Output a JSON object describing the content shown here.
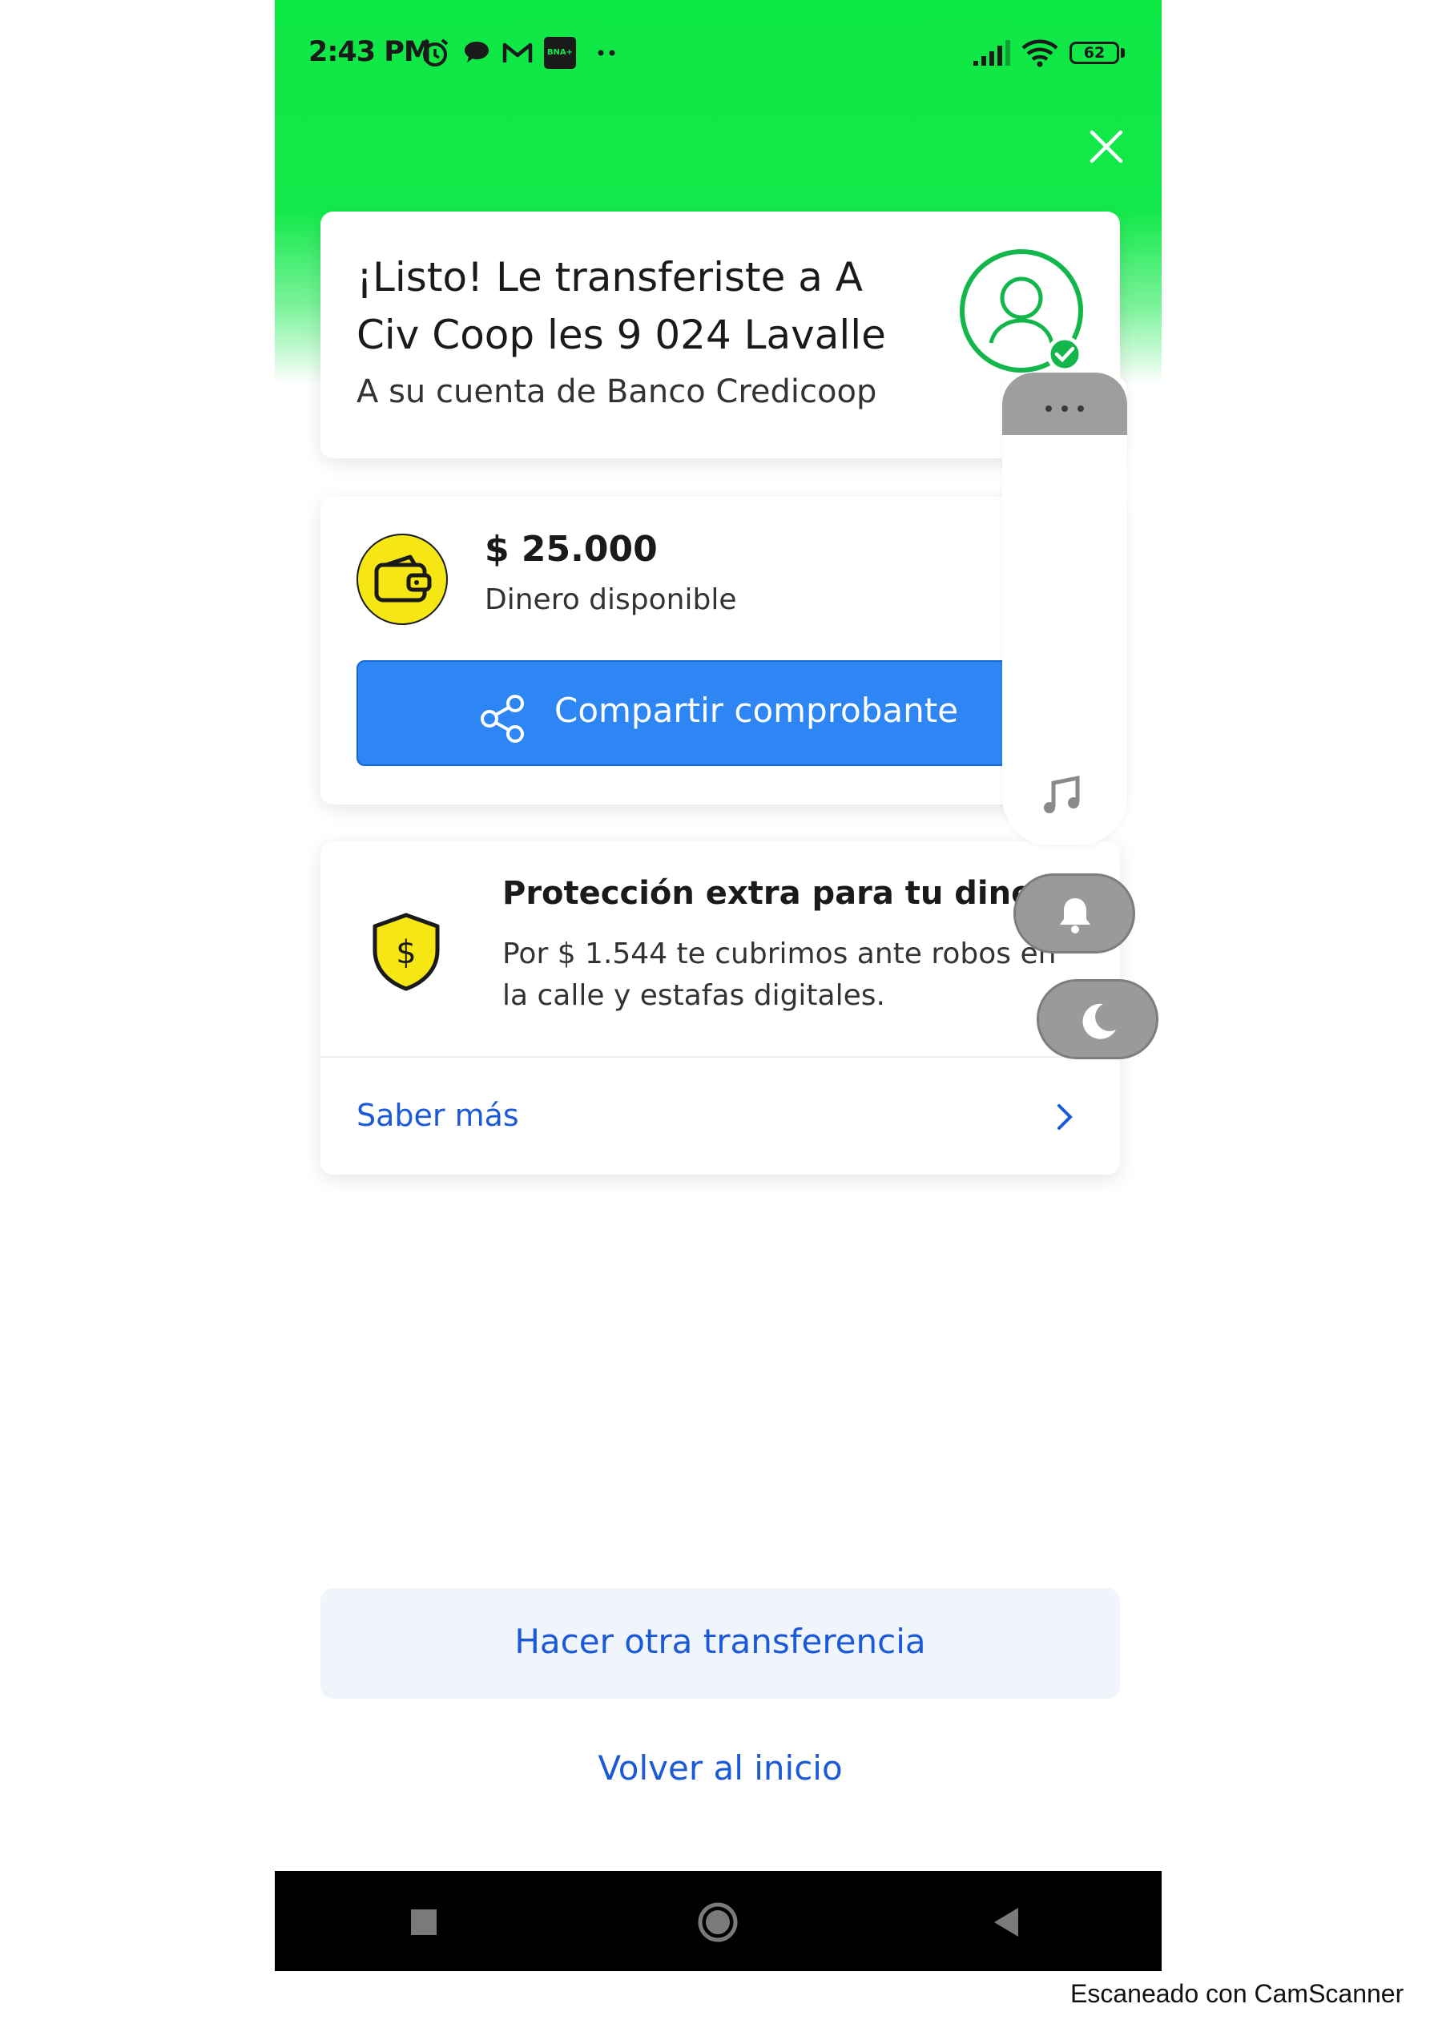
{
  "status_bar": {
    "time": "2:43 PM",
    "notification_icons": [
      "alarm-icon",
      "chat-icon",
      "gmail-icon",
      "bna-app-icon",
      "more-notifications-icon"
    ],
    "bna_label": "BNA+",
    "battery": "62",
    "system_icons": [
      "signal-icon",
      "wifi-icon",
      "battery-icon"
    ]
  },
  "success_card": {
    "title": "¡Listo! Le transferiste a A Civ Coop les 9 024 Lavalle",
    "subtitle": "A su cuenta de Banco Credicoop",
    "avatar_icon": "user-check-icon"
  },
  "balance_card": {
    "amount": "$ 25.000",
    "label": "Dinero disponible",
    "share_button": "Compartir comprobante"
  },
  "protection_card": {
    "title": "Protección extra para tu dinero",
    "description": "Por $ 1.544 te cubrimos ante robos en la calle y estafas digitales.",
    "link": "Saber más"
  },
  "actions": {
    "another_transfer": "Hacer otra transferencia",
    "back_home": "Volver al inicio"
  },
  "navigation": [
    "recents-button",
    "home-button",
    "back-button"
  ],
  "watermark": "Escaneado con CamScanner",
  "colors": {
    "header_green": "#13e94a",
    "primary_blue": "#2d86f3",
    "link_blue": "#1b5ad6",
    "success_green": "#12b64a",
    "icon_yellow": "#f5e614"
  }
}
